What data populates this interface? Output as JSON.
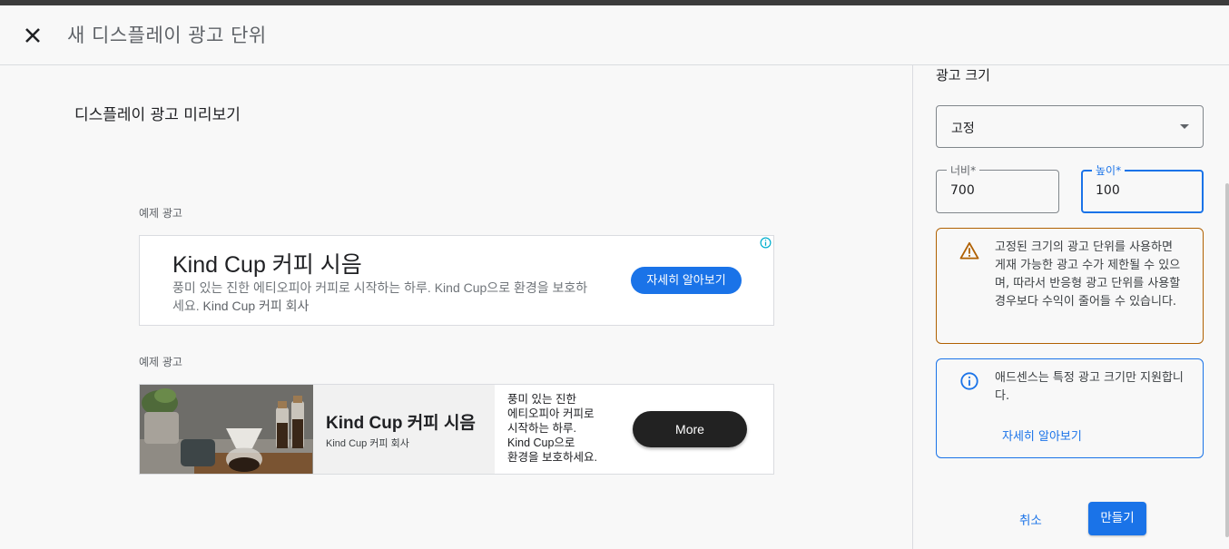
{
  "header": {
    "title": "새 디스플레이 광고 단위"
  },
  "preview": {
    "title": "디스플레이 광고 미리보기",
    "ad_label_1": "예제 광고",
    "ad_label_2": "예제 광고",
    "ad1": {
      "headline": "Kind Cup 커피 시음",
      "body": "풍미 있는 진한 에티오피아 커피로 시작하는 하루. Kind Cup으로 환경을 보호하세요.",
      "company": "Kind Cup 커피 회사",
      "cta": "자세히 알아보기"
    },
    "ad2": {
      "headline": "Kind Cup 커피 시음",
      "company": "Kind Cup 커피 회사",
      "desc": [
        "풍미 있는 진한",
        "에티오피아 커피로",
        "시작하는 하루.",
        "Kind Cup으로",
        "환경을 보호하세요."
      ],
      "cta": "More"
    }
  },
  "side": {
    "title": "광고 크기",
    "size_select": {
      "value": "고정"
    },
    "width": {
      "label": "너비*",
      "value": "700"
    },
    "height": {
      "label": "높이*",
      "value": "100"
    },
    "warning": "고정된 크기의 광고 단위를 사용하면 게재 가능한 광고 수가 제한될 수 있으며, 따라서 반응형 광고 단위를 사용할 경우보다 수익이 줄어들 수 있습니다.",
    "info": {
      "text": "애드센스는 특정 광고 크기만 지원합니다.",
      "link": "자세히 알아보기"
    },
    "cancel_label": "취소",
    "create_label": "만들기"
  },
  "colors": {
    "accent": "#1a73e8",
    "warning_border": "#b06000",
    "ad2_button": "#222222"
  }
}
